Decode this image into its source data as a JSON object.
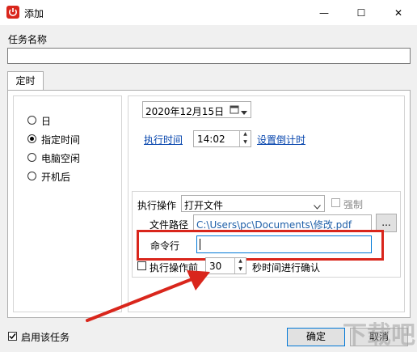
{
  "window": {
    "title": "添加",
    "minimize_glyph": "—",
    "maximize_glyph": "☐",
    "close_glyph": "✕"
  },
  "task_name": {
    "label": "任务名称",
    "value": ""
  },
  "tabs": [
    {
      "label": "定时"
    }
  ],
  "trigger_options": [
    {
      "label": "日",
      "checked": false
    },
    {
      "label": "指定时间",
      "checked": true
    },
    {
      "label": "电脑空闲",
      "checked": false
    },
    {
      "label": "开机后",
      "checked": false
    }
  ],
  "schedule": {
    "date_value": "2020年12月15日",
    "exec_time_label": "执行时间",
    "time_value": "14:02",
    "countdown_link": "设置倒计时"
  },
  "action": {
    "label": "执行操作",
    "selected": "打开文件",
    "force_label": "强制",
    "path_label": "文件路径",
    "path_value": "C:\\Users\\pc\\Documents\\修改.pdf",
    "browse_label": "...",
    "cmd_label": "命令行",
    "cmd_value": "",
    "confirm_before_label": "执行操作前",
    "confirm_seconds": "30",
    "confirm_suffix": "秒时间进行确认"
  },
  "footer": {
    "enable_label": "启用该任务",
    "enable_checked": true,
    "ok_label": "确定",
    "cancel_label": "取消"
  },
  "watermark": "下载吧",
  "colors": {
    "highlight": "#d9261c",
    "link": "#0645ad",
    "path_text": "#1f5fa8"
  }
}
